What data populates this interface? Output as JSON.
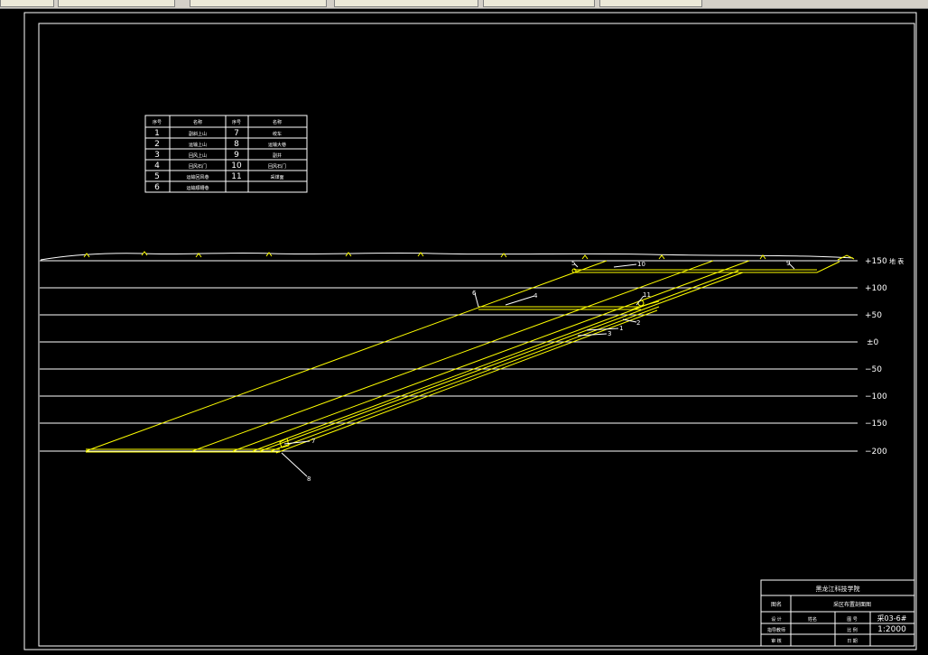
{
  "toolbar": {
    "segments": [
      "",
      "",
      "",
      "",
      "",
      ""
    ]
  },
  "legend": {
    "headers": [
      "序号",
      "名称",
      "序号",
      "名称"
    ],
    "rows": [
      [
        "1",
        "副斜上山",
        "7",
        "绞车"
      ],
      [
        "2",
        "运输上山",
        "8",
        "运输大巷"
      ],
      [
        "3",
        "回风上山",
        "9",
        "副井"
      ],
      [
        "4",
        "回风石门",
        "10",
        "回风石门"
      ],
      [
        "5",
        "运输回风巷",
        "11",
        "采煤面"
      ],
      [
        "6",
        "运输顺槽巷",
        "",
        ""
      ]
    ]
  },
  "elevations": [
    "+150",
    "+100",
    "+50",
    "±0",
    "−50",
    "−100",
    "−150",
    "−200"
  ],
  "surface_label": "地 表",
  "callouts": [
    "1",
    "2",
    "3",
    "4",
    "5",
    "6",
    "7",
    "8",
    "9",
    "10",
    "11"
  ],
  "title_block": {
    "school": "黑龙江科技学院",
    "drawing_name_label": "图名",
    "drawing_name": "采区布置剖面图",
    "designer_label": "设 计",
    "designer": "姓名",
    "drawing_no_label": "图 号",
    "drawing_no": "采03-6#",
    "reviewer_label": "指导教师",
    "scale_label": "比 例",
    "scale": "1:2000",
    "approver_label": "审 核",
    "date_label": "日 期"
  },
  "colors": {
    "background": "#000000",
    "frame": "#ffffff",
    "level_lines": "#ffffff",
    "roadways": "#ffff00",
    "text": "#ffffff"
  }
}
